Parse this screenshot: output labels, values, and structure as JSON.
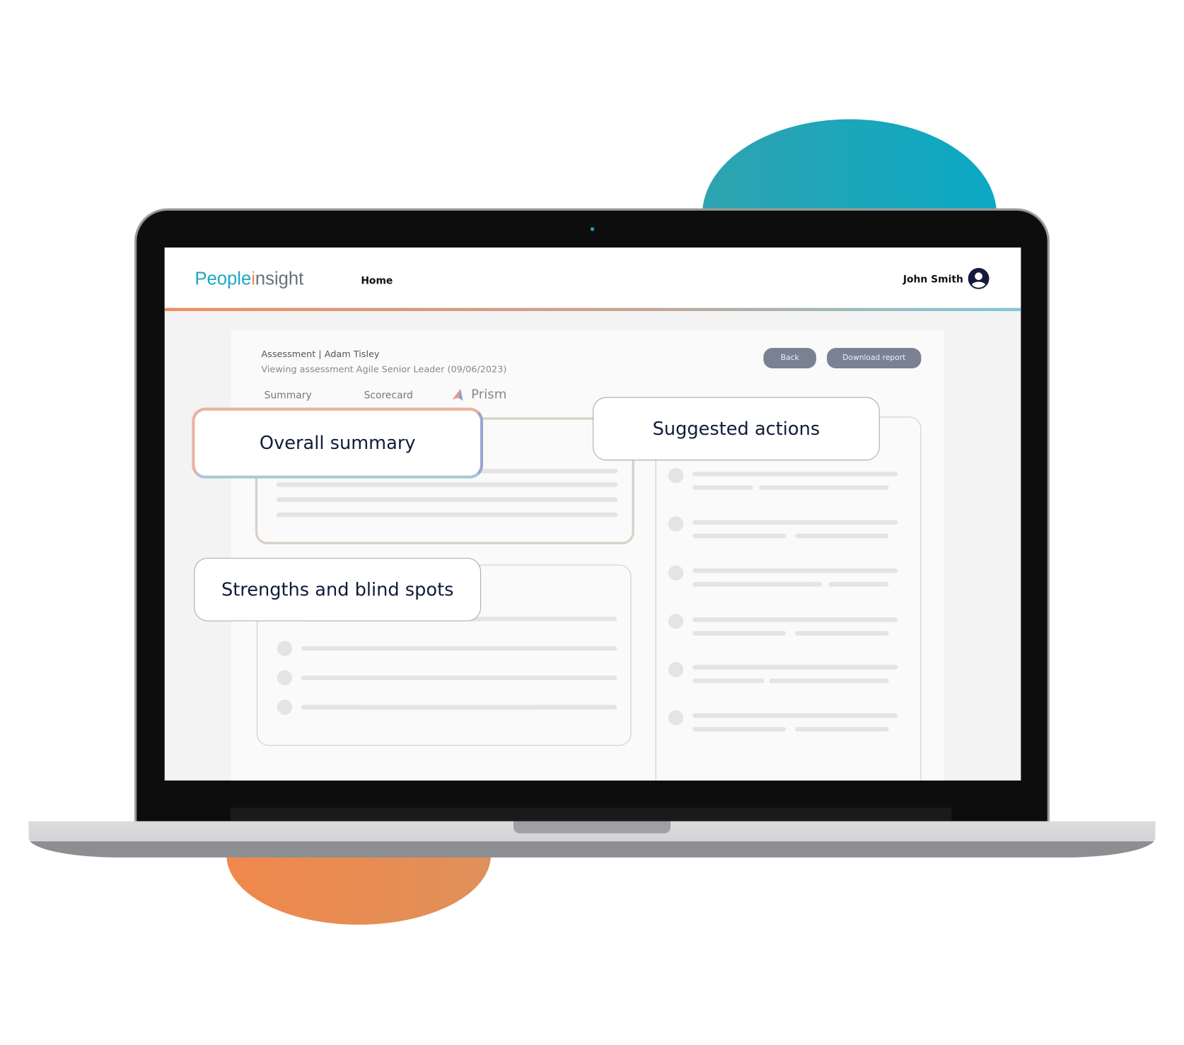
{
  "header": {
    "logo_people": "People",
    "logo_i": "i",
    "logo_rest": "nsight",
    "nav_home": "Home",
    "user_name": "John Smith"
  },
  "page": {
    "breadcrumb": "Assessment | Adam Tisley",
    "subtitle": "Viewing assessment Agile Senior Leader (09/06/2023)",
    "back_label": "Back",
    "download_label": "Download report"
  },
  "tabs": [
    {
      "label": "Summary"
    },
    {
      "label": "Scorecard"
    },
    {
      "label": "Prism"
    }
  ],
  "callouts": {
    "overall": "Overall summary",
    "suggested": "Suggested actions",
    "strengths": "Strengths and blind spots"
  },
  "colors": {
    "teal": "#0aa9c4",
    "orange": "#ef8a55",
    "button": "#7a8193",
    "navy": "#121a3a"
  }
}
